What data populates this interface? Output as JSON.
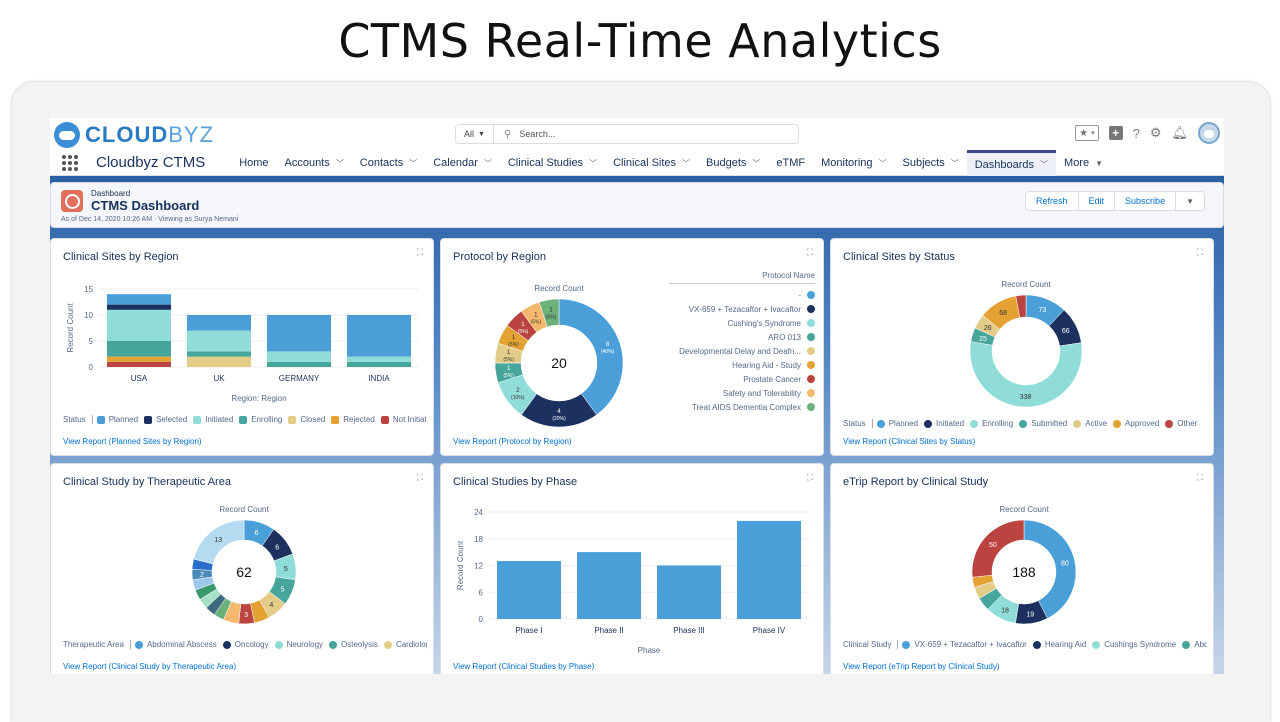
{
  "hero_title": "CTMS Real-Time Analytics",
  "brand": {
    "bold": "CLOUD",
    "light": "BYZ"
  },
  "search": {
    "scope": "All",
    "placeholder": "Search..."
  },
  "app_name": "Cloudbyz CTMS",
  "nav": [
    {
      "label": "Home",
      "chevron": false
    },
    {
      "label": "Accounts",
      "chevron": true
    },
    {
      "label": "Contacts",
      "chevron": true
    },
    {
      "label": "Calendar",
      "chevron": true
    },
    {
      "label": "Clinical Studies",
      "chevron": true
    },
    {
      "label": "Clinical Sites",
      "chevron": true
    },
    {
      "label": "Budgets",
      "chevron": true
    },
    {
      "label": "eTMF",
      "chevron": false
    },
    {
      "label": "Monitoring",
      "chevron": true
    },
    {
      "label": "Subjects",
      "chevron": true
    },
    {
      "label": "Dashboards",
      "chevron": true,
      "active": true
    },
    {
      "label": "More",
      "chevron": true
    }
  ],
  "dashboard": {
    "kicker": "Dashboard",
    "title": "CTMS Dashboard",
    "subtitle": "As of Dec 14, 2020 10:26 AM · Viewing as Surya Nemani",
    "buttons": {
      "refresh": "Refresh",
      "edit": "Edit",
      "subscribe": "Subscribe"
    }
  },
  "colors": {
    "blue": "#4a9fd9",
    "navy": "#1c3160",
    "lightteal": "#8fdcd8",
    "teal": "#46a69c",
    "sand": "#e3cc88",
    "orange": "#e3a232",
    "red": "#bb4440",
    "peach": "#f5b96e",
    "green": "#6cb07a"
  },
  "cards": {
    "sites_region": {
      "title": "Clinical Sites by Region",
      "link": "View Report (Planned Sites by Region)",
      "legend_title": "Status",
      "chart_data": {
        "type": "bar",
        "stacked": true,
        "title": "Clinical Sites by Region",
        "xlabel": "Region: Region",
        "ylabel": "Record Count",
        "ylim": [
          0,
          15
        ],
        "yticks": [
          0,
          5,
          10,
          15
        ],
        "categories": [
          "USA",
          "UK",
          "GERMANY",
          "INDIA"
        ],
        "series": [
          {
            "name": "Not Initiated",
            "color": "#bb4440",
            "values": [
              1,
              0,
              0,
              0
            ]
          },
          {
            "name": "Rejected",
            "color": "#e3a232",
            "values": [
              1,
              0,
              0,
              0
            ]
          },
          {
            "name": "Closed",
            "color": "#e3cc88",
            "values": [
              0,
              2,
              0,
              0
            ]
          },
          {
            "name": "Enrolling",
            "color": "#46a69c",
            "values": [
              3,
              1,
              1,
              1
            ]
          },
          {
            "name": "Initiated",
            "color": "#8fdcd8",
            "values": [
              6,
              4,
              2,
              1
            ]
          },
          {
            "name": "Selected",
            "color": "#1c3160",
            "values": [
              1,
              0,
              0,
              0
            ]
          },
          {
            "name": "Planned",
            "color": "#4a9fd9",
            "values": [
              2,
              3,
              7,
              8
            ]
          }
        ],
        "legend_order": [
          "Planned",
          "Selected",
          "Initiated",
          "Enrolling",
          "Closed",
          "Rejected",
          "Not Initiated"
        ]
      }
    },
    "protocol_region": {
      "title": "Protocol by Region",
      "link": "View Report (Protocol by Region)",
      "legend_title": "Protocol Name",
      "chart_data": {
        "type": "pie",
        "donut": true,
        "title": "Record Count",
        "total": 20,
        "slices": [
          {
            "label": "-",
            "value": 8,
            "pct": "40%",
            "color": "#4a9fd9"
          },
          {
            "label": "VX-659 + Tezacaftor + Ivacaftor",
            "value": 4,
            "pct": "20%",
            "color": "#1c3160"
          },
          {
            "label": "Cushing's Syndrome",
            "value": 2,
            "pct": "10%",
            "color": "#8fdcd8"
          },
          {
            "label": "ARO 013",
            "value": 1,
            "pct": "5%",
            "color": "#46a69c"
          },
          {
            "label": "Developmental Delay and Deafn...",
            "value": 1,
            "pct": "5%",
            "color": "#e3cc88"
          },
          {
            "label": "Hearing Aid - Study",
            "value": 1,
            "pct": "5%",
            "color": "#e3a232"
          },
          {
            "label": "Prostate Cancer",
            "value": 1,
            "pct": "5%",
            "color": "#bb4440"
          },
          {
            "label": "Safety and Tolerability",
            "value": 1,
            "pct": "5%",
            "color": "#f5b96e"
          },
          {
            "label": "Treat AIDS Dementia Complex",
            "value": 1,
            "pct": "5%",
            "color": "#6cb07a"
          }
        ]
      }
    },
    "sites_status": {
      "title": "Clinical Sites by Status",
      "link": "View Report (Clinical Sites by Status)",
      "legend_title": "Status",
      "chart_data": {
        "type": "pie",
        "donut": true,
        "title": "Record Count",
        "slices": [
          {
            "label": "Planned",
            "value": 73,
            "color": "#4a9fd9"
          },
          {
            "label": "Initiated",
            "value": 66,
            "color": "#1c3160"
          },
          {
            "label": "Enrolling",
            "value": 338,
            "color": "#8fdcd8"
          },
          {
            "label": "Submitted",
            "value": 25,
            "color": "#46a69c"
          },
          {
            "label": "Active",
            "value": 26,
            "color": "#e3cc88"
          },
          {
            "label": "Approved",
            "value": 68,
            "color": "#e3a232"
          },
          {
            "label": "Other",
            "value": 18,
            "color": "#bb4440",
            "hide_label": true
          }
        ]
      }
    },
    "study_area": {
      "title": "Clinical Study by Therapeutic Area",
      "link": "View Report (Clinical Study by Therapeutic Area)",
      "legend_title": "Therapeutic Area",
      "chart_data": {
        "type": "pie",
        "donut": true,
        "title": "Record Count",
        "total": 62,
        "slices": [
          {
            "label": "Abdominal Abscess",
            "value": 6,
            "color": "#4a9fd9"
          },
          {
            "label": "Oncology",
            "value": 6,
            "color": "#1c3160"
          },
          {
            "label": "Neurology",
            "value": 5,
            "color": "#8fdcd8"
          },
          {
            "label": "Osteolysis",
            "value": 5,
            "color": "#46a69c"
          },
          {
            "label": "Cardiology",
            "value": 4,
            "color": "#e3cc88"
          },
          {
            "label": "",
            "value": 3,
            "color": "#e3a232",
            "hide_label": true
          },
          {
            "label": "",
            "value": 3,
            "color": "#bb4440"
          },
          {
            "label": "",
            "value": 3,
            "color": "#f5b96e",
            "hide_label": true
          },
          {
            "label": "",
            "value": 2,
            "color": "#6cb07a",
            "hide_label": true
          },
          {
            "label": "",
            "value": 2,
            "color": "#3c6a7e",
            "hide_label": true
          },
          {
            "label": "",
            "value": 2,
            "color": "#a6e0c6",
            "hide_label": true
          },
          {
            "label": "",
            "value": 2,
            "color": "#3a9a6c",
            "hide_label": true
          },
          {
            "label": "",
            "value": 2,
            "color": "#9cc8ec",
            "hide_label": true
          },
          {
            "label": "",
            "value": 2,
            "color": "#4a8ab8"
          },
          {
            "label": "",
            "value": 2,
            "color": "#2a6fd0",
            "hide_label": true
          },
          {
            "label": "",
            "value": 13,
            "color": "#b4dbf0"
          }
        ],
        "legend_visible": [
          "Abdominal Abscess",
          "Oncology",
          "Neurology",
          "Osteolysis",
          "Cardiology"
        ]
      }
    },
    "studies_phase": {
      "title": "Clinical Studies by Phase",
      "link": "View Report (Clinical Studies by Phase)",
      "chart_data": {
        "type": "bar",
        "title": "Clinical Studies by Phase",
        "xlabel": "Phase",
        "ylabel": "Record Count",
        "ylim": [
          0,
          24
        ],
        "yticks": [
          0,
          6,
          12,
          18,
          24
        ],
        "categories": [
          "Phase I",
          "Phase II",
          "Phase III",
          "Phase IV"
        ],
        "values": [
          13,
          15,
          12,
          22
        ],
        "color": "#4a9fd9"
      }
    },
    "etrip": {
      "title": "eTrip Report by Clinical Study",
      "link": "View Report (eTrip Report by Clinical Study)",
      "legend_title": "Clinical Study",
      "chart_data": {
        "type": "pie",
        "donut": true,
        "title": "Record Count",
        "total": 188,
        "slices": [
          {
            "label": "VX-659 + Tezacaftor + Ivacaftor",
            "value": 80,
            "color": "#4a9fd9"
          },
          {
            "label": "Hearing Aid",
            "value": 19,
            "color": "#1c3160"
          },
          {
            "label": "Cushings Syndrome",
            "value": 18,
            "color": "#8fdcd8"
          },
          {
            "label": "Abdo",
            "value": 8,
            "color": "#46a69c",
            "hide_label": true
          },
          {
            "label": "",
            "value": 7,
            "color": "#e3cc88",
            "hide_label": true
          },
          {
            "label": "",
            "value": 6,
            "color": "#e3a232",
            "hide_label": true
          },
          {
            "label": "",
            "value": 50,
            "color": "#bb4440"
          }
        ],
        "legend_visible": [
          "VX-659 + Tezacaftor + Ivacaftor",
          "Hearing Aid",
          "Cushings Syndrome",
          "Abdo"
        ]
      }
    }
  }
}
